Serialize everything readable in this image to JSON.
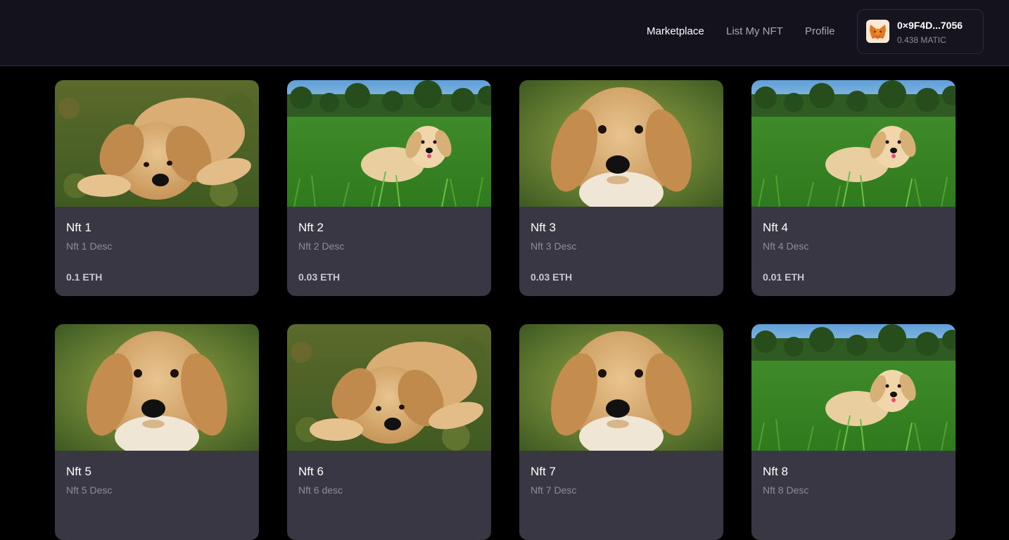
{
  "header": {
    "nav": [
      {
        "label": "Marketplace",
        "active": true
      },
      {
        "label": "List My NFT",
        "active": false
      },
      {
        "label": "Profile",
        "active": false
      }
    ],
    "wallet": {
      "icon": "metamask-fox-icon",
      "address": "0×9F4D...7056",
      "balance": "0.438 MATIC"
    }
  },
  "colors": {
    "background": "#000000",
    "header_bg": "#13121d",
    "card_bg": "#393743",
    "text_primary": "#ffffff",
    "text_muted": "#8e8c98"
  },
  "nfts": [
    {
      "title": "Nft 1",
      "desc": "Nft 1 Desc",
      "price": "0.1 ETH",
      "image": "puppy-lying-on-grass"
    },
    {
      "title": "Nft 2",
      "desc": "Nft 2 Desc",
      "price": "0.03 ETH",
      "image": "puppy-in-field-with-trees"
    },
    {
      "title": "Nft 3",
      "desc": "Nft 3 Desc",
      "price": "0.03 ETH",
      "image": "puppy-face-closeup"
    },
    {
      "title": "Nft 4",
      "desc": "Nft 4 Desc",
      "price": "0.01 ETH",
      "image": "puppy-in-field-with-trees"
    },
    {
      "title": "Nft 5",
      "desc": "Nft 5 Desc",
      "price": "",
      "image": "puppy-face-closeup"
    },
    {
      "title": "Nft 6",
      "desc": "Nft 6 desc",
      "price": "",
      "image": "puppy-lying-on-grass"
    },
    {
      "title": "Nft 7",
      "desc": "Nft 7 Desc",
      "price": "",
      "image": "puppy-face-closeup"
    },
    {
      "title": "Nft 8",
      "desc": "Nft 8 Desc",
      "price": "",
      "image": "puppy-in-field-with-trees"
    }
  ]
}
